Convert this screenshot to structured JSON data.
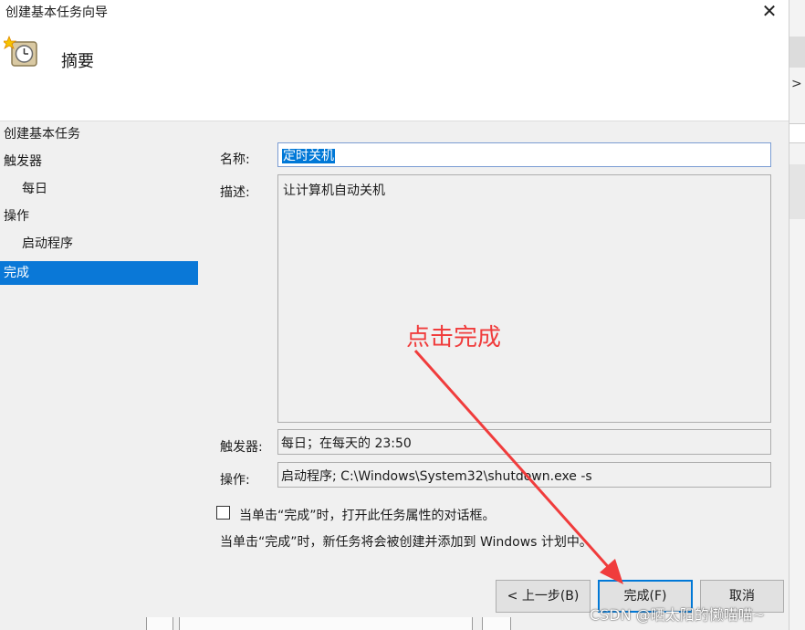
{
  "window": {
    "title": "创建基本任务向导",
    "header": "摘要"
  },
  "nav": {
    "items": [
      {
        "label": "创建基本任务",
        "level": 0,
        "active": false
      },
      {
        "label": "触发器",
        "level": 0,
        "active": false
      },
      {
        "label": "每日",
        "level": 1,
        "active": false
      },
      {
        "label": "操作",
        "level": 0,
        "active": false
      },
      {
        "label": "启动程序",
        "level": 1,
        "active": false
      },
      {
        "label": "完成",
        "level": 0,
        "active": true
      }
    ]
  },
  "form": {
    "name_label": "名称:",
    "name_value": "定时关机",
    "desc_label": "描述:",
    "desc_value": "让计算机自动关机",
    "trigger_label": "触发器:",
    "trigger_value": "每日；在每天的 23:50",
    "action_label": "操作:",
    "action_value": "启动程序; C:\\Windows\\System32\\shutdown.exe  -s",
    "checkbox_label": "当单击“完成”时，打开此任务属性的对话框。",
    "checkbox_checked": false,
    "info_text": "当单击“完成”时，新任务将会被创建并添加到 Windows 计划中。"
  },
  "buttons": {
    "back": "< 上一步(B)",
    "finish": "完成(F)",
    "cancel": "取消"
  },
  "annotation": {
    "text": "点击完成",
    "color": "#f03c3c"
  },
  "watermark": "CSDN @晒太阳的懒喵喵~",
  "colors": {
    "selection": "#0a78d7",
    "accent": "#0078d7"
  }
}
